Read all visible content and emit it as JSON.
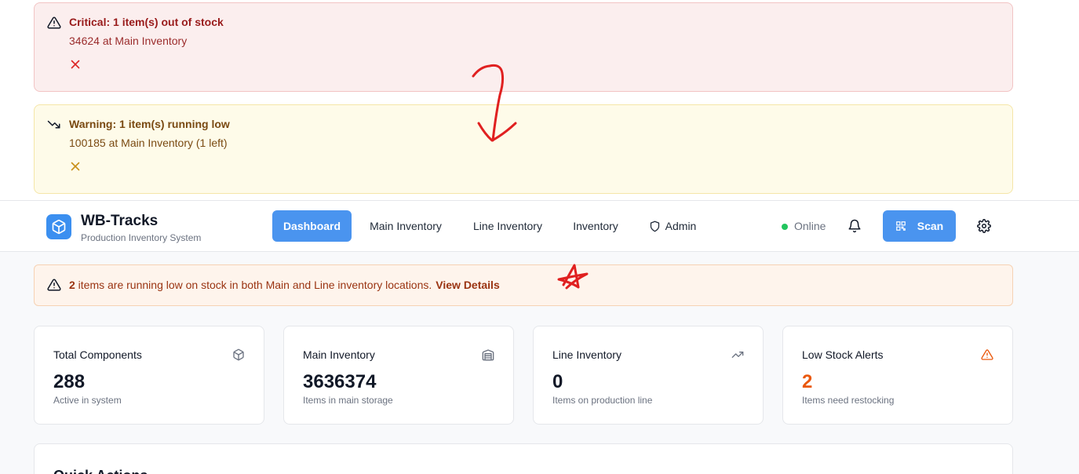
{
  "alerts": {
    "critical": {
      "title": "Critical: 1 item(s) out of stock",
      "message": "34624 at Main Inventory"
    },
    "warning": {
      "title": "Warning: 1 item(s) running low",
      "message": "100185 at Main Inventory (1 left)"
    }
  },
  "header": {
    "app_title": "WB-Tracks",
    "app_subtitle": "Production Inventory System",
    "nav": {
      "dashboard": "Dashboard",
      "main_inventory": "Main Inventory",
      "line_inventory": "Line Inventory",
      "inventory": "Inventory",
      "admin": "Admin"
    },
    "status": "Online",
    "scan_label": "Scan"
  },
  "low_stock_banner": {
    "count": "2",
    "text": " items are running low on stock in both Main and Line inventory locations.",
    "link": "View Details"
  },
  "cards": [
    {
      "title": "Total Components",
      "value": "288",
      "subtitle": "Active in system",
      "icon": "box-icon"
    },
    {
      "title": "Main Inventory",
      "value": "3636374",
      "subtitle": "Items in main storage",
      "icon": "warehouse-icon"
    },
    {
      "title": "Line Inventory",
      "value": "0",
      "subtitle": "Items on production line",
      "icon": "trending-up-icon"
    },
    {
      "title": "Low Stock Alerts",
      "value": "2",
      "subtitle": "Items need restocking",
      "icon": "warning-icon"
    }
  ],
  "quick_actions": {
    "title": "Quick Actions"
  },
  "colors": {
    "primary": "#4a94ef",
    "critical": "#991b1b",
    "warning": "#7a4a12",
    "low_stock": "#ea580c",
    "online": "#22c55e",
    "annotation": "#e02020"
  }
}
